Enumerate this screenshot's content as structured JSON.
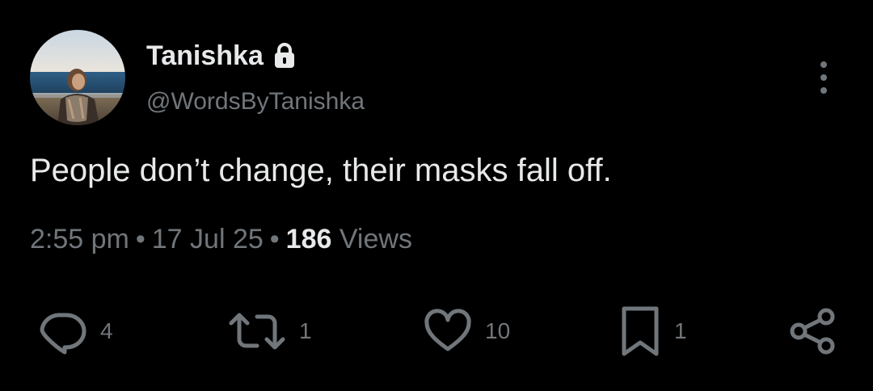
{
  "author": {
    "display_name": "Tanishka",
    "handle": "@WordsByTanishka",
    "protected_icon": "lock-icon"
  },
  "tweet": {
    "text": "People don’t change, their masks fall off.",
    "time": "2:55 pm",
    "date": "17 Jul 25",
    "separator": "•",
    "views_count": "186",
    "views_label": "Views"
  },
  "actions": {
    "reply": {
      "icon": "reply-icon",
      "count": "4"
    },
    "repost": {
      "icon": "repost-icon",
      "count": "1"
    },
    "like": {
      "icon": "heart-icon",
      "count": "10"
    },
    "bookmark": {
      "icon": "bookmark-icon",
      "count": "1"
    },
    "share": {
      "icon": "share-icon"
    }
  },
  "colors": {
    "background": "#000000",
    "primary_text": "#e7e9ea",
    "secondary_text": "#71767b"
  }
}
